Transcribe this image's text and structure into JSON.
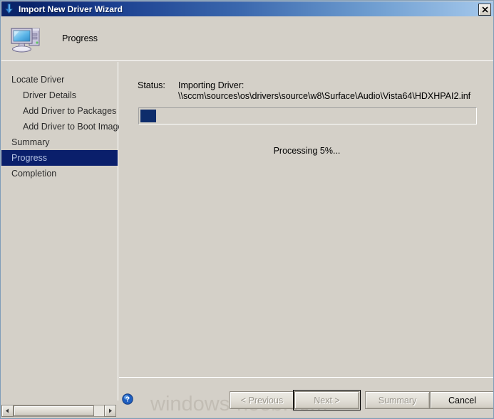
{
  "window": {
    "title": "Import New Driver Wizard",
    "title_icon": "import-arrow-icon",
    "close_label": "✕",
    "accent_titlebar_dark": "#0a246a",
    "accent_titlebar_light": "#a6c9ec",
    "face_color": "#d4d0c8"
  },
  "header": {
    "icon": "computer-icon",
    "title": "Progress"
  },
  "sidebar": {
    "items": [
      {
        "label": "Locate Driver",
        "indent": false,
        "active": false
      },
      {
        "label": "Driver Details",
        "indent": true,
        "active": false
      },
      {
        "label": "Add Driver to Packages",
        "indent": true,
        "active": false
      },
      {
        "label": "Add Driver to Boot Images",
        "indent": true,
        "active": false
      },
      {
        "label": "Summary",
        "indent": false,
        "active": false
      },
      {
        "label": "Progress",
        "indent": false,
        "active": true
      },
      {
        "label": "Completion",
        "indent": false,
        "active": false
      }
    ],
    "active_bg": "#0a1f6b",
    "active_fg": "#b6c4e4"
  },
  "status": {
    "label": "Status:",
    "line1": "Importing Driver:",
    "line2": "\\\\sccm\\sources\\os\\drivers\\source\\w8\\Surface\\Audio\\Vista64\\HDXHPAI2.inf"
  },
  "progress": {
    "percent": 5,
    "fill_width_css": "4.6%",
    "fill_color": "#0d2c6b",
    "processing_text": "Processing 5%..."
  },
  "footer": {
    "help_icon": "help-question-icon",
    "watermark": "windows-noob.com",
    "buttons": [
      {
        "key": "previous",
        "label": "< Previous",
        "enabled": false,
        "focused": false
      },
      {
        "key": "next",
        "label": "Next >",
        "enabled": false,
        "focused": true
      },
      {
        "key": "summary",
        "label": "Summary",
        "enabled": false,
        "focused": false
      },
      {
        "key": "cancel",
        "label": "Cancel",
        "enabled": true,
        "focused": false
      }
    ]
  },
  "scrollbar": {
    "left_arrow": "◄",
    "right_arrow": "►",
    "orientation": "horizontal"
  }
}
